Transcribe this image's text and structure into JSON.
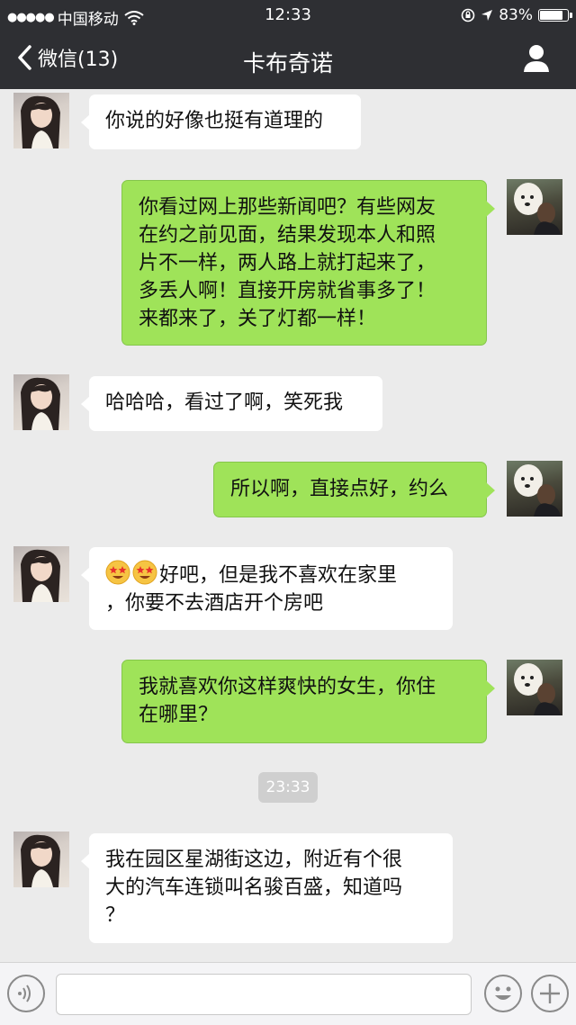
{
  "status_bar": {
    "carrier": "中国移动",
    "time": "12:33",
    "battery": "83%",
    "battery_level": 0.83
  },
  "nav": {
    "back_label": "微信(13)",
    "title": "卡布奇诺"
  },
  "messages": [
    {
      "side": "left",
      "text": "你说的好像也挺有道理的"
    },
    {
      "side": "right",
      "lines": [
        "你看过网上那些新闻吧？有些网友",
        "在约之前见面，结果发现本人和照",
        "片不一样，两人路上就打起来了，",
        "多丢人啊！直接开房就省事多了！",
        "来都来了，关了灯都一样！"
      ]
    },
    {
      "side": "left",
      "text": "哈哈哈，看过了啊，笑死我"
    },
    {
      "side": "right",
      "text": "所以啊，直接点好，约么"
    },
    {
      "side": "left",
      "emoji_count": 2,
      "lines": [
        "好吧，但是我不喜欢在家里",
        "，你要不去酒店开个房吧"
      ]
    },
    {
      "side": "right",
      "lines": [
        "我就喜欢你这样爽快的女生，你住",
        "在哪里？"
      ]
    },
    {
      "side": "left",
      "lines": [
        "我在园区星湖街这边，附近有个很",
        "大的汽车连锁叫名骏百盛，知道吗",
        "？"
      ]
    }
  ],
  "timestamp": "23:33",
  "input": {
    "value": "",
    "placeholder": ""
  },
  "colors": {
    "header_bg": "#2e2f33",
    "chat_bg": "#ebebeb",
    "outgoing_bubble": "#9fe359",
    "incoming_bubble": "#ffffff"
  },
  "icons": [
    "signal-dots-icon",
    "wifi-icon",
    "lock-rotation-icon",
    "location-arrow-icon",
    "battery-icon",
    "back-chevron-icon",
    "profile-icon",
    "voice-icon",
    "emoji-icon",
    "plus-icon"
  ]
}
